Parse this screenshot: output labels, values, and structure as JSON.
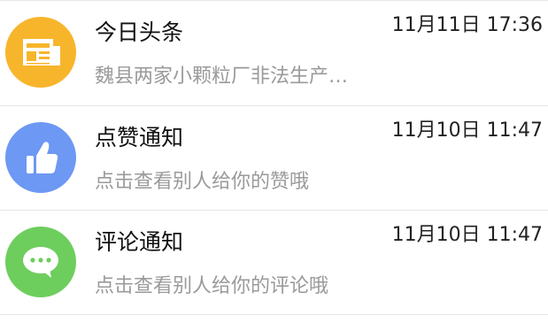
{
  "messages": [
    {
      "title": "今日头条",
      "time": "11月11日 17:36",
      "preview": "魏县两家小颗粒厂非法生产…",
      "icon": "newspaper-icon",
      "color": "#F7B52C"
    },
    {
      "title": "点赞通知",
      "time": "11月10日 11:47",
      "preview": "点击查看别人给你的赞哦",
      "icon": "thumbs-up-icon",
      "color": "#6D98F3"
    },
    {
      "title": "评论通知",
      "time": "11月10日 11:47",
      "preview": "点击查看别人给你的评论哦",
      "icon": "chat-bubble-icon",
      "color": "#6DCE5D"
    }
  ]
}
